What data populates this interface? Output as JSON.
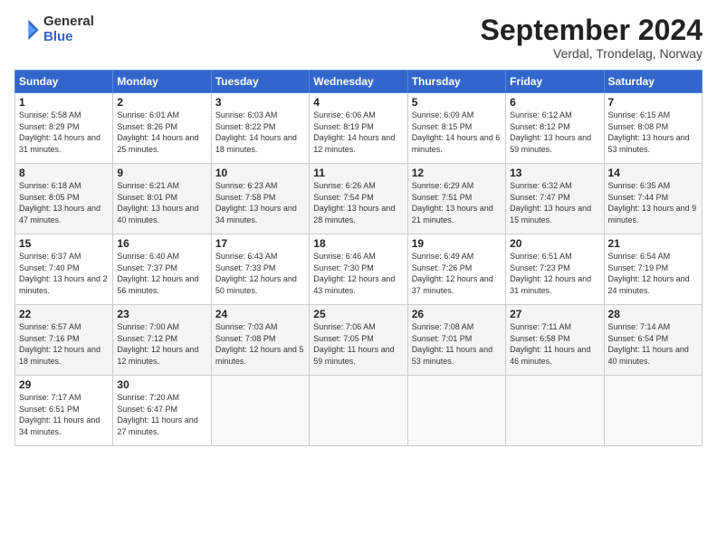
{
  "logo": {
    "general": "General",
    "blue": "Blue"
  },
  "title": "September 2024",
  "subtitle": "Verdal, Trondelag, Norway",
  "headers": [
    "Sunday",
    "Monday",
    "Tuesday",
    "Wednesday",
    "Thursday",
    "Friday",
    "Saturday"
  ],
  "weeks": [
    [
      {
        "day": "1",
        "sunrise": "5:58 AM",
        "sunset": "8:29 PM",
        "daylight": "14 hours and 31 minutes."
      },
      {
        "day": "2",
        "sunrise": "6:01 AM",
        "sunset": "8:26 PM",
        "daylight": "14 hours and 25 minutes."
      },
      {
        "day": "3",
        "sunrise": "6:03 AM",
        "sunset": "8:22 PM",
        "daylight": "14 hours and 18 minutes."
      },
      {
        "day": "4",
        "sunrise": "6:06 AM",
        "sunset": "8:19 PM",
        "daylight": "14 hours and 12 minutes."
      },
      {
        "day": "5",
        "sunrise": "6:09 AM",
        "sunset": "8:15 PM",
        "daylight": "14 hours and 6 minutes."
      },
      {
        "day": "6",
        "sunrise": "6:12 AM",
        "sunset": "8:12 PM",
        "daylight": "13 hours and 59 minutes."
      },
      {
        "day": "7",
        "sunrise": "6:15 AM",
        "sunset": "8:08 PM",
        "daylight": "13 hours and 53 minutes."
      }
    ],
    [
      {
        "day": "8",
        "sunrise": "6:18 AM",
        "sunset": "8:05 PM",
        "daylight": "13 hours and 47 minutes."
      },
      {
        "day": "9",
        "sunrise": "6:21 AM",
        "sunset": "8:01 PM",
        "daylight": "13 hours and 40 minutes."
      },
      {
        "day": "10",
        "sunrise": "6:23 AM",
        "sunset": "7:58 PM",
        "daylight": "13 hours and 34 minutes."
      },
      {
        "day": "11",
        "sunrise": "6:26 AM",
        "sunset": "7:54 PM",
        "daylight": "13 hours and 28 minutes."
      },
      {
        "day": "12",
        "sunrise": "6:29 AM",
        "sunset": "7:51 PM",
        "daylight": "13 hours and 21 minutes."
      },
      {
        "day": "13",
        "sunrise": "6:32 AM",
        "sunset": "7:47 PM",
        "daylight": "13 hours and 15 minutes."
      },
      {
        "day": "14",
        "sunrise": "6:35 AM",
        "sunset": "7:44 PM",
        "daylight": "13 hours and 9 minutes."
      }
    ],
    [
      {
        "day": "15",
        "sunrise": "6:37 AM",
        "sunset": "7:40 PM",
        "daylight": "13 hours and 2 minutes."
      },
      {
        "day": "16",
        "sunrise": "6:40 AM",
        "sunset": "7:37 PM",
        "daylight": "12 hours and 56 minutes."
      },
      {
        "day": "17",
        "sunrise": "6:43 AM",
        "sunset": "7:33 PM",
        "daylight": "12 hours and 50 minutes."
      },
      {
        "day": "18",
        "sunrise": "6:46 AM",
        "sunset": "7:30 PM",
        "daylight": "12 hours and 43 minutes."
      },
      {
        "day": "19",
        "sunrise": "6:49 AM",
        "sunset": "7:26 PM",
        "daylight": "12 hours and 37 minutes."
      },
      {
        "day": "20",
        "sunrise": "6:51 AM",
        "sunset": "7:23 PM",
        "daylight": "12 hours and 31 minutes."
      },
      {
        "day": "21",
        "sunrise": "6:54 AM",
        "sunset": "7:19 PM",
        "daylight": "12 hours and 24 minutes."
      }
    ],
    [
      {
        "day": "22",
        "sunrise": "6:57 AM",
        "sunset": "7:16 PM",
        "daylight": "12 hours and 18 minutes."
      },
      {
        "day": "23",
        "sunrise": "7:00 AM",
        "sunset": "7:12 PM",
        "daylight": "12 hours and 12 minutes."
      },
      {
        "day": "24",
        "sunrise": "7:03 AM",
        "sunset": "7:08 PM",
        "daylight": "12 hours and 5 minutes."
      },
      {
        "day": "25",
        "sunrise": "7:06 AM",
        "sunset": "7:05 PM",
        "daylight": "11 hours and 59 minutes."
      },
      {
        "day": "26",
        "sunrise": "7:08 AM",
        "sunset": "7:01 PM",
        "daylight": "11 hours and 53 minutes."
      },
      {
        "day": "27",
        "sunrise": "7:11 AM",
        "sunset": "6:58 PM",
        "daylight": "11 hours and 46 minutes."
      },
      {
        "day": "28",
        "sunrise": "7:14 AM",
        "sunset": "6:54 PM",
        "daylight": "11 hours and 40 minutes."
      }
    ],
    [
      {
        "day": "29",
        "sunrise": "7:17 AM",
        "sunset": "6:51 PM",
        "daylight": "11 hours and 34 minutes."
      },
      {
        "day": "30",
        "sunrise": "7:20 AM",
        "sunset": "6:47 PM",
        "daylight": "11 hours and 27 minutes."
      },
      null,
      null,
      null,
      null,
      null
    ]
  ]
}
